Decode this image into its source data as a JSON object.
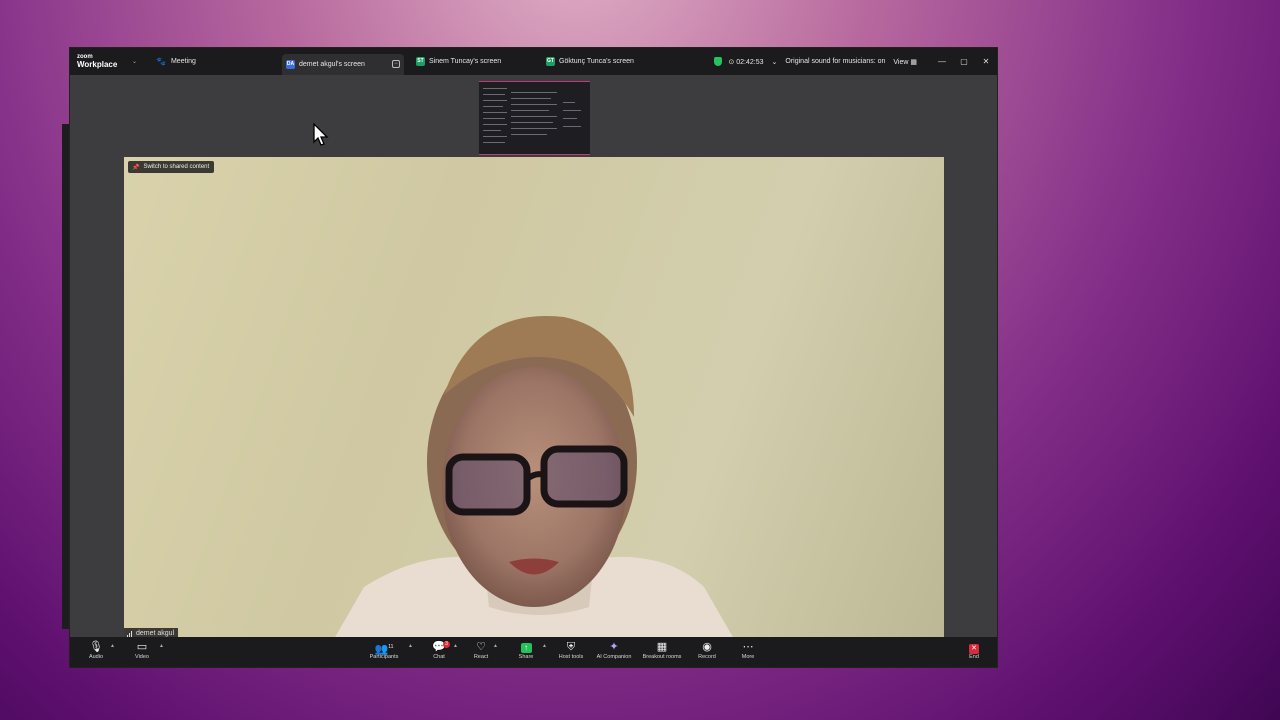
{
  "titlebar": {
    "logo_top": "zoom",
    "logo_bottom": "Workplace",
    "meeting_tab": "Meeting",
    "tabs": [
      {
        "initials": "DA",
        "label": "demet akgul's screen",
        "color": "#3b6fd8"
      },
      {
        "initials": "ST",
        "label": "Sinem Tuncay's screen",
        "color": "#1e9e64"
      },
      {
        "initials": "GT",
        "label": "Göktunç Tunca's screen",
        "color": "#1e9e64"
      }
    ],
    "timer": "⊙ 02:42:53",
    "timer_caret": "⌄",
    "original_sound": "Original sound for musicians: on",
    "view": "View ▦"
  },
  "video": {
    "switch_label": "Switch to shared content",
    "participant_name": "demet akgul"
  },
  "toolbar": {
    "audio": "Audio",
    "video": "Video",
    "participants": "Participants",
    "participants_count": "11",
    "chat": "Chat",
    "chat_badge": "3",
    "react": "React",
    "share": "Share",
    "host_tools": "Host tools",
    "ai_companion": "AI Companion",
    "breakout_rooms": "Breakout rooms",
    "record": "Record",
    "more": "More",
    "end": "End"
  }
}
